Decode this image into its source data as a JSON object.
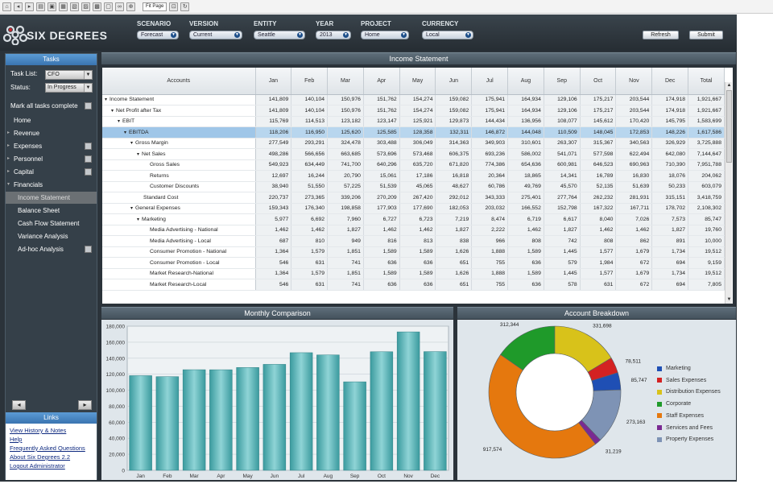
{
  "toolbar": {
    "zoom": "Fit Page"
  },
  "brand": {
    "name": "SIX DEGREES"
  },
  "filters": [
    {
      "label": "SCENARIO",
      "value": "Forecast"
    },
    {
      "label": "VERSION",
      "value": "Current"
    },
    {
      "label": "ENTITY",
      "value": "Seattle"
    },
    {
      "label": "YEAR",
      "value": "2013"
    },
    {
      "label": "PROJECT",
      "value": "Home"
    },
    {
      "label": "CURRENCY",
      "value": "Local"
    }
  ],
  "actions": {
    "refresh": "Refresh",
    "submit": "Submit"
  },
  "tasks": {
    "title": "Tasks",
    "task_list_label": "Task List:",
    "task_list_value": "CFO",
    "status_label": "Status:",
    "status_value": "In Progress",
    "mark_all": "Mark all tasks complete"
  },
  "nav": [
    {
      "label": "Home",
      "level": "top",
      "tri": "",
      "check": false,
      "active": false
    },
    {
      "label": "Revenue",
      "level": "top",
      "tri": "▸",
      "check": false,
      "active": false
    },
    {
      "label": "Expenses",
      "level": "top",
      "tri": "▸",
      "check": true,
      "active": false
    },
    {
      "label": "Personnel",
      "level": "top",
      "tri": "▸",
      "check": true,
      "active": false
    },
    {
      "label": "Capital",
      "level": "top",
      "tri": "▸",
      "check": true,
      "active": false
    },
    {
      "label": "Financials",
      "level": "top",
      "tri": "▾",
      "check": false,
      "active": false
    },
    {
      "label": "Income Statement",
      "level": "sub",
      "tri": "",
      "check": false,
      "active": true
    },
    {
      "label": "Balance Sheet",
      "level": "sub",
      "tri": "",
      "check": false,
      "active": false
    },
    {
      "label": "Cash Flow Statement",
      "level": "sub",
      "tri": "",
      "check": false,
      "active": false
    },
    {
      "label": "Variance Analysis",
      "level": "sub",
      "tri": "",
      "check": false,
      "active": false
    },
    {
      "label": "Ad-hoc Analysis",
      "level": "sub",
      "tri": "",
      "check": true,
      "active": false
    }
  ],
  "links": {
    "title": "Links",
    "items": [
      "View History & Notes",
      "Help",
      "Frequently Asked Questions",
      "About Six Degrees 2.2",
      "Logout Administrator"
    ]
  },
  "income_statement": {
    "title": "Income Statement",
    "columns": [
      "Accounts",
      "Jan",
      "Feb",
      "Mar",
      "Apr",
      "May",
      "Jun",
      "Jul",
      "Aug",
      "Sep",
      "Oct",
      "Nov",
      "Dec",
      "Total"
    ],
    "rows": [
      {
        "account": "Income Statement",
        "depth": 0,
        "toggle": "▾",
        "highlight": false,
        "values": [
          "141,809",
          "140,104",
          "150,976",
          "151,762",
          "154,274",
          "159,082",
          "175,941",
          "164,934",
          "129,106",
          "175,217",
          "203,544",
          "174,918",
          "1,921,667"
        ]
      },
      {
        "account": "Net Profit after Tax",
        "depth": 1,
        "toggle": "▾",
        "highlight": false,
        "values": [
          "141,809",
          "140,104",
          "150,976",
          "151,762",
          "154,274",
          "159,082",
          "175,941",
          "164,934",
          "129,106",
          "175,217",
          "203,544",
          "174,918",
          "1,921,667"
        ]
      },
      {
        "account": "EBIT",
        "depth": 2,
        "toggle": "▾",
        "highlight": false,
        "values": [
          "115,769",
          "114,513",
          "123,182",
          "123,147",
          "125,921",
          "129,873",
          "144,434",
          "136,956",
          "108,077",
          "145,612",
          "170,420",
          "145,795",
          "1,583,699"
        ]
      },
      {
        "account": "EBITDA",
        "depth": 3,
        "toggle": "▾",
        "highlight": true,
        "values": [
          "118,206",
          "116,950",
          "125,620",
          "125,585",
          "128,358",
          "132,311",
          "146,872",
          "144,048",
          "110,509",
          "148,045",
          "172,853",
          "148,226",
          "1,617,586"
        ]
      },
      {
        "account": "Gross Margin",
        "depth": 4,
        "toggle": "▾",
        "highlight": false,
        "values": [
          "277,549",
          "293,291",
          "324,478",
          "303,488",
          "306,049",
          "314,363",
          "349,903",
          "310,601",
          "263,307",
          "315,367",
          "340,563",
          "326,929",
          "3,725,888"
        ]
      },
      {
        "account": "Net Sales",
        "depth": 5,
        "toggle": "▾",
        "highlight": false,
        "values": [
          "498,286",
          "566,656",
          "663,685",
          "573,696",
          "573,468",
          "606,375",
          "693,236",
          "586,002",
          "541,071",
          "577,598",
          "622,494",
          "642,080",
          "7,144,647"
        ]
      },
      {
        "account": "Gross Sales",
        "depth": 7,
        "toggle": "",
        "highlight": false,
        "values": [
          "549,923",
          "634,449",
          "741,700",
          "640,296",
          "635,720",
          "671,820",
          "774,386",
          "654,636",
          "600,981",
          "646,523",
          "690,963",
          "710,390",
          "7,951,788"
        ]
      },
      {
        "account": "Returns",
        "depth": 7,
        "toggle": "",
        "highlight": false,
        "values": [
          "12,697",
          "16,244",
          "20,790",
          "15,061",
          "17,186",
          "16,818",
          "20,364",
          "18,865",
          "14,341",
          "16,789",
          "16,830",
          "18,076",
          "204,062"
        ]
      },
      {
        "account": "Customer Discounts",
        "depth": 7,
        "toggle": "",
        "highlight": false,
        "values": [
          "38,940",
          "51,550",
          "57,225",
          "51,539",
          "45,065",
          "48,627",
          "60,786",
          "49,769",
          "45,570",
          "52,135",
          "51,639",
          "50,233",
          "603,079"
        ]
      },
      {
        "account": "Standard Cost",
        "depth": 6,
        "toggle": "",
        "highlight": false,
        "values": [
          "220,737",
          "273,365",
          "339,206",
          "270,209",
          "267,420",
          "292,012",
          "343,333",
          "275,401",
          "277,764",
          "262,232",
          "281,931",
          "315,151",
          "3,418,759"
        ]
      },
      {
        "account": "General Expenses",
        "depth": 4,
        "toggle": "▾",
        "highlight": false,
        "values": [
          "159,343",
          "176,340",
          "198,858",
          "177,903",
          "177,690",
          "182,053",
          "203,032",
          "166,552",
          "152,798",
          "167,322",
          "167,711",
          "178,702",
          "2,108,302"
        ]
      },
      {
        "account": "Marketing",
        "depth": 5,
        "toggle": "▾",
        "highlight": false,
        "values": [
          "5,977",
          "6,692",
          "7,960",
          "6,727",
          "6,723",
          "7,219",
          "8,474",
          "6,719",
          "6,617",
          "8,040",
          "7,026",
          "7,573",
          "85,747"
        ]
      },
      {
        "account": "Media Advertising - National",
        "depth": 7,
        "toggle": "",
        "highlight": false,
        "values": [
          "1,462",
          "1,462",
          "1,827",
          "1,462",
          "1,462",
          "1,827",
          "2,222",
          "1,462",
          "1,827",
          "1,462",
          "1,462",
          "1,827",
          "19,760"
        ]
      },
      {
        "account": "Media Advertising - Local",
        "depth": 7,
        "toggle": "",
        "highlight": false,
        "values": [
          "687",
          "810",
          "949",
          "816",
          "813",
          "838",
          "966",
          "808",
          "742",
          "808",
          "862",
          "891",
          "10,000"
        ]
      },
      {
        "account": "Consumer Promotion - National",
        "depth": 7,
        "toggle": "",
        "highlight": false,
        "values": [
          "1,364",
          "1,579",
          "1,851",
          "1,589",
          "1,589",
          "1,626",
          "1,888",
          "1,589",
          "1,445",
          "1,577",
          "1,679",
          "1,734",
          "19,512"
        ]
      },
      {
        "account": "Consumer Promotion - Local",
        "depth": 7,
        "toggle": "",
        "highlight": false,
        "values": [
          "546",
          "631",
          "741",
          "636",
          "636",
          "651",
          "755",
          "636",
          "579",
          "1,984",
          "672",
          "694",
          "9,159"
        ]
      },
      {
        "account": "Market Research-National",
        "depth": 7,
        "toggle": "",
        "highlight": false,
        "values": [
          "1,364",
          "1,579",
          "1,851",
          "1,589",
          "1,589",
          "1,626",
          "1,888",
          "1,589",
          "1,445",
          "1,577",
          "1,679",
          "1,734",
          "19,512"
        ]
      },
      {
        "account": "Market Research-Local",
        "depth": 7,
        "toggle": "",
        "highlight": false,
        "values": [
          "546",
          "631",
          "741",
          "636",
          "636",
          "651",
          "755",
          "636",
          "578",
          "631",
          "672",
          "694",
          "7,805"
        ]
      }
    ]
  },
  "chart_data": [
    {
      "type": "bar",
      "title": "Monthly Comparison",
      "categories": [
        "Jan",
        "Feb",
        "Mar",
        "Apr",
        "May",
        "Jun",
        "Jul",
        "Aug",
        "Sep",
        "Oct",
        "Nov",
        "Dec"
      ],
      "values": [
        118206,
        116950,
        125620,
        125585,
        128358,
        132311,
        146872,
        144048,
        110509,
        148045,
        172853,
        148226
      ],
      "ylim": [
        0,
        180000
      ],
      "yticks": [
        "0",
        "20,000",
        "40,000",
        "60,000",
        "80,000",
        "100,000",
        "120,000",
        "140,000",
        "160,000",
        "180,000"
      ],
      "grid": true,
      "color": "#5fb8bb"
    },
    {
      "type": "pie",
      "title": "Account Breakdown",
      "categories": [
        "Marketing",
        "Sales Expenses",
        "Distribution Expenses",
        "Corporate",
        "Staff Expenses",
        "Services and Fees",
        "Property Expenses"
      ],
      "values": [
        85747,
        78511,
        331698,
        312344,
        917574,
        31219,
        273163
      ],
      "labels": [
        "85,747",
        "78,511",
        "331,698",
        "312,344",
        "917,574",
        "31,219",
        "273,163"
      ],
      "colors": [
        "#1f4fb4",
        "#d42222",
        "#d8c21a",
        "#1f9a2a",
        "#e5780e",
        "#7a2a92",
        "#7e93b5"
      ],
      "legend": "right"
    }
  ]
}
